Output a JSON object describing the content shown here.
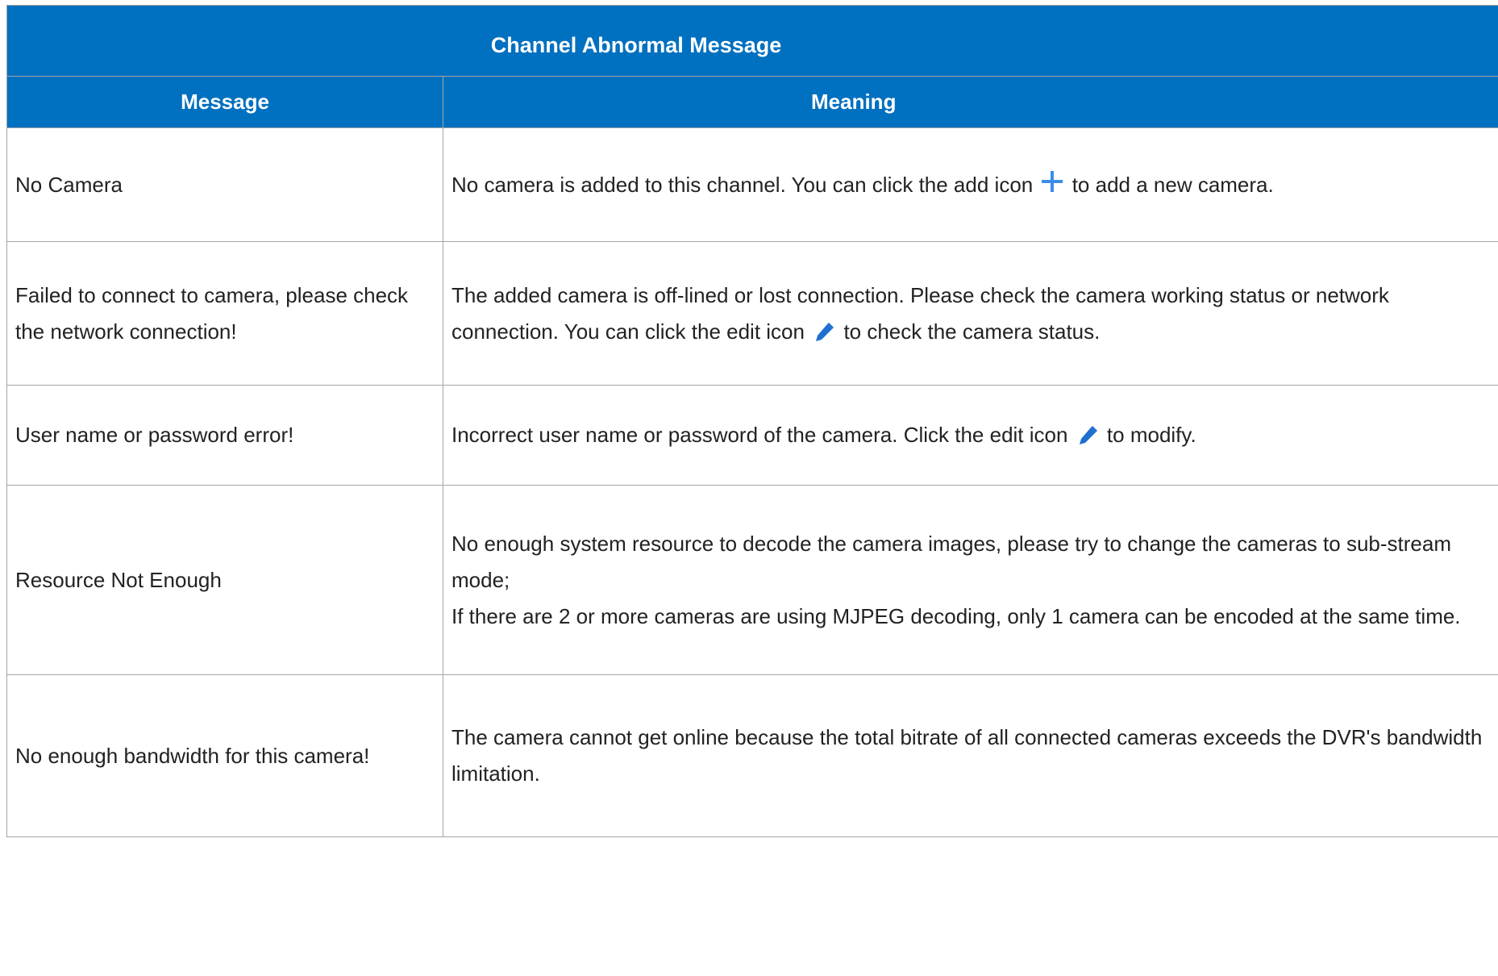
{
  "table": {
    "title": "Channel Abnormal Message",
    "headers": [
      "Message",
      "Meaning"
    ],
    "rows": [
      {
        "message": "No Camera",
        "meaning_before_icon": "No camera is added to this channel. You can click the add icon",
        "icon": "plus-icon",
        "meaning_after_icon": "to add a new camera."
      },
      {
        "message": "Failed to connect to camera, please check the network connection!",
        "meaning_before_icon": "The added camera is off-lined or lost connection. Please check the camera working status or network connection. You can click the edit icon",
        "icon": "pencil-icon",
        "meaning_after_icon": "to check the camera status."
      },
      {
        "message": "User name or password error!",
        "meaning_before_icon": "Incorrect user name or password of the camera. Click the edit icon",
        "icon": "pencil-icon",
        "meaning_after_icon": "to modify."
      },
      {
        "message": "Resource Not Enough",
        "meaning_lines": [
          "No enough system resource to decode the camera images, please try to change the cameras to sub-stream mode;",
          "If there are 2 or more cameras are using MJPEG decoding, only 1 camera can be encoded at the same time."
        ]
      },
      {
        "message": "No enough bandwidth for this camera!",
        "meaning": "The camera cannot get online because the total bitrate of all connected cameras exceeds the DVR's bandwidth limitation."
      }
    ]
  },
  "colors": {
    "header_bg": "#0070c0",
    "header_text": "#ffffff",
    "border": "#a6a6a6",
    "icon_blue": "#3a8ee6"
  }
}
